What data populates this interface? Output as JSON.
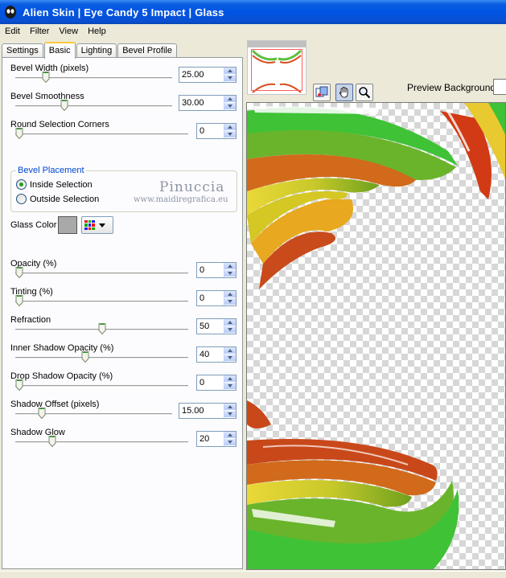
{
  "window": {
    "title": "Alien Skin  |  Eye Candy 5 Impact  |  Glass"
  },
  "menu": [
    "Edit",
    "Filter",
    "View",
    "Help"
  ],
  "tabs": [
    {
      "label": "Settings",
      "active": false
    },
    {
      "label": "Basic",
      "active": true
    },
    {
      "label": "Lighting",
      "active": false
    },
    {
      "label": "Bevel Profile",
      "active": false
    }
  ],
  "sliders": {
    "bevel_width": {
      "label": "Bevel Width (pixels)",
      "value": "25.00",
      "level": 0.18
    },
    "bevel_smoothness": {
      "label": "Bevel Smoothness",
      "value": "30.00",
      "level": 0.3
    },
    "round_corners": {
      "label": "Round Selection Corners",
      "value": "0",
      "level": 0.0
    },
    "opacity": {
      "label": "Opacity (%)",
      "value": "0",
      "level": 0.0
    },
    "tinting": {
      "label": "Tinting (%)",
      "value": "0",
      "level": 0.0
    },
    "refraction": {
      "label": "Refraction",
      "value": "50",
      "level": 0.5
    },
    "inner_shadow_opacity": {
      "label": "Inner Shadow Opacity (%)",
      "value": "40",
      "level": 0.4
    },
    "drop_shadow_opacity": {
      "label": "Drop Shadow Opacity (%)",
      "value": "0",
      "level": 0.0
    },
    "shadow_offset": {
      "label": "Shadow Offset (pixels)",
      "value": "15.00",
      "level": 0.15
    },
    "shadow_glow": {
      "label": "Shadow Glow",
      "value": "20",
      "level": 0.2
    }
  },
  "bevel_placement": {
    "legend": "Bevel Placement",
    "inside_label": "Inside Selection",
    "outside_label": "Outside Selection",
    "selected": "inside"
  },
  "watermark": {
    "name": "Pinuccia",
    "site": "www.maidiregrafica.eu"
  },
  "glass_color": {
    "label": "Glass Color",
    "color": "#a9a9a9"
  },
  "preview": {
    "background_label": "Preview Background:"
  },
  "colors": {
    "titlebar": "#0054e3",
    "tab_highlight": "#ffc83c",
    "group_legend": "#0046d5"
  }
}
